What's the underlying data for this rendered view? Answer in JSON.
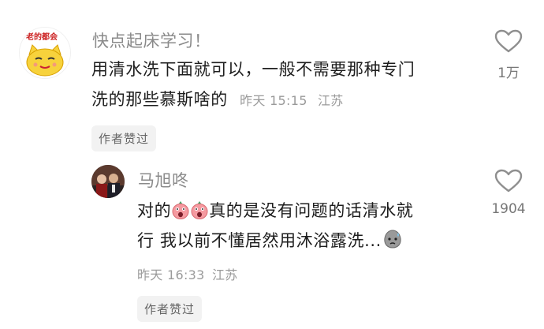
{
  "comment": {
    "username": "快点起床学习！",
    "text_line1": "用清水洗下面就可以，一般不需要那种专门",
    "text_line2": "洗的那些慕斯啥的",
    "time": "昨天 15:15",
    "location": "江苏",
    "badge": "作者赞过",
    "likes": "1万",
    "avatar_caption": "老的都会"
  },
  "reply": {
    "username": "马旭咚",
    "text_line1_prefix": "对的",
    "text_line1_suffix": "真的是没有问题的话清水就",
    "text_line2": "行 我以前不懂居然用沐浴露洗...",
    "time": "昨天 16:33",
    "location": "江苏",
    "badge": "作者赞过",
    "likes": "1904"
  },
  "colors": {
    "avatar_yellow": "#f7d23c",
    "emoji_pink": "#f59aa0",
    "badge_bg": "#f2f2f2"
  }
}
